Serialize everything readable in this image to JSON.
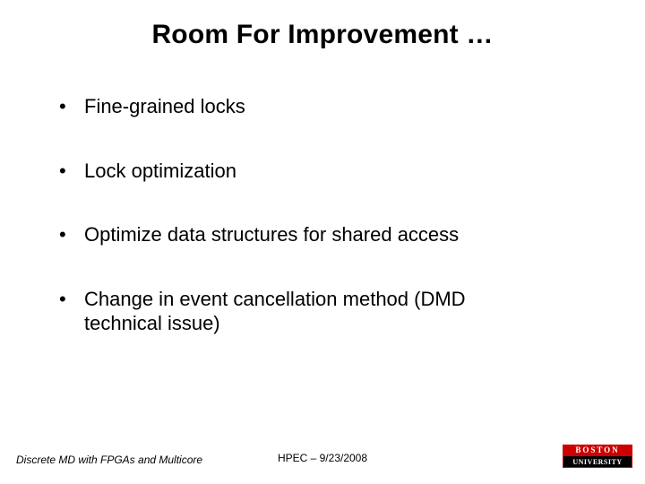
{
  "title": "Room For Improvement …",
  "bullets": [
    {
      "text": "Fine-grained locks",
      "cont": ""
    },
    {
      "text": "Lock optimization",
      "cont": ""
    },
    {
      "text": "Optimize data structures for shared access",
      "cont": ""
    },
    {
      "text": "Change in event cancellation method (DMD",
      "cont": "technical issue)"
    }
  ],
  "footer": {
    "left": "Discrete MD with FPGAs and Multicore",
    "center": "HPEC  –  9/23/2008"
  },
  "logo": {
    "top": "BOSTON",
    "bottom": "UNIVERSITY"
  }
}
